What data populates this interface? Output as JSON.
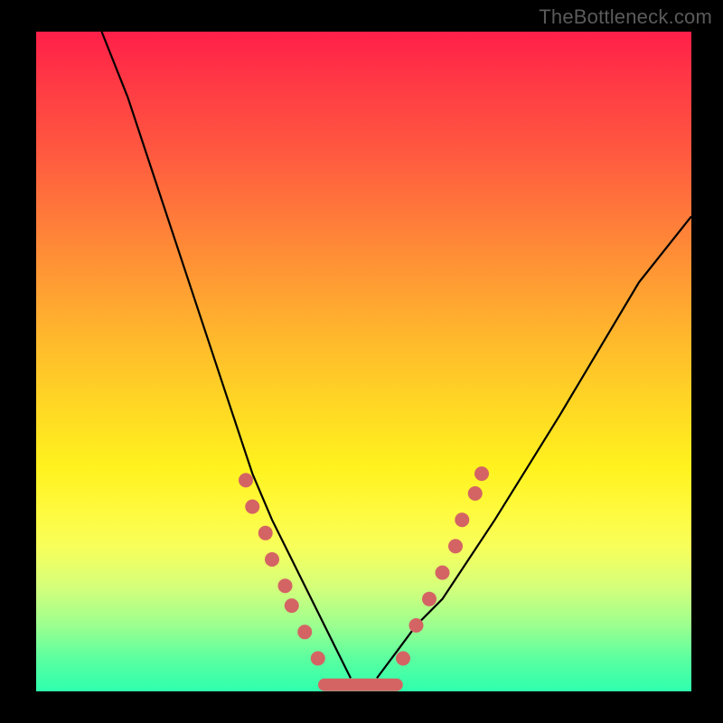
{
  "watermark_text": "TheBottleneck.com",
  "chart_data": {
    "type": "line",
    "title": "",
    "xlabel": "",
    "ylabel": "",
    "xlim": [
      0,
      100
    ],
    "ylim": [
      0,
      100
    ],
    "grid": false,
    "legend": false,
    "background_gradient": {
      "direction": "vertical",
      "top_color": "#ff1f49",
      "mid_colors": [
        "#ff7a3a",
        "#ffdb23",
        "#fff93b"
      ],
      "bottom_color": "#2effad",
      "description": "red (top) → orange → yellow → green (bottom) heatmap-style band"
    },
    "series": [
      {
        "name": "left-curve",
        "description": "steep descending curve from upper-left edge toward valley floor",
        "x": [
          10,
          14,
          18,
          22,
          26,
          30,
          33,
          36,
          39,
          42,
          44,
          46,
          48
        ],
        "y": [
          100,
          90,
          78,
          66,
          54,
          42,
          33,
          26,
          20,
          14,
          10,
          6,
          2
        ]
      },
      {
        "name": "right-curve",
        "description": "rising curve from valley floor toward right edge, shallower than left",
        "x": [
          52,
          55,
          58,
          62,
          66,
          70,
          75,
          80,
          86,
          92,
          100
        ],
        "y": [
          2,
          6,
          10,
          14,
          20,
          26,
          34,
          42,
          52,
          62,
          72
        ]
      },
      {
        "name": "valley-floor",
        "description": "short flat segment at the bottom connecting the two curves, drawn thick pink",
        "x": [
          44,
          55
        ],
        "y": [
          1,
          1
        ],
        "color": "#d46464"
      }
    ],
    "markers": {
      "description": "pink circular dots along lower portions of both curves near the valley",
      "color": "#d46464",
      "radius_px_approx": 8,
      "points": [
        {
          "curve": "left",
          "x": 32,
          "y": 32
        },
        {
          "curve": "left",
          "x": 33,
          "y": 28
        },
        {
          "curve": "left",
          "x": 35,
          "y": 24
        },
        {
          "curve": "left",
          "x": 36,
          "y": 20
        },
        {
          "curve": "left",
          "x": 38,
          "y": 16
        },
        {
          "curve": "left",
          "x": 39,
          "y": 13
        },
        {
          "curve": "left",
          "x": 41,
          "y": 9
        },
        {
          "curve": "left",
          "x": 43,
          "y": 5
        },
        {
          "curve": "right",
          "x": 56,
          "y": 5
        },
        {
          "curve": "right",
          "x": 58,
          "y": 10
        },
        {
          "curve": "right",
          "x": 60,
          "y": 14
        },
        {
          "curve": "right",
          "x": 62,
          "y": 18
        },
        {
          "curve": "right",
          "x": 64,
          "y": 22
        },
        {
          "curve": "right",
          "x": 65,
          "y": 26
        },
        {
          "curve": "right",
          "x": 67,
          "y": 30
        },
        {
          "curve": "right",
          "x": 68,
          "y": 33
        }
      ]
    }
  }
}
